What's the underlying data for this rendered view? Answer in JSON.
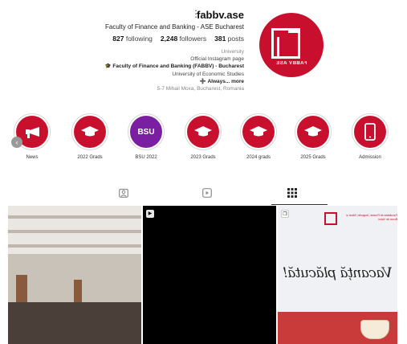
{
  "profile": {
    "username": "fabbv.ase",
    "more_icon": "more-dots-icon",
    "display_name": "Faculty of Finance and Banking - ASE Bucharest",
    "stats": {
      "posts_value": "381",
      "posts_label": "posts",
      "followers_value": "2,248",
      "followers_label": "followers",
      "following_value": "827",
      "following_label": "following"
    },
    "bio": {
      "category": "University",
      "line1": "Official Instagram page",
      "line2": "🎓 Faculty of Finance and Banking (FABBV) - Bucharest",
      "line3": "University of Economic Studies",
      "line4": "➕ Always... more",
      "line5": "5-7 Mihail Moxa, Bucharest, Romania"
    },
    "avatar_text": "FABBV ASE",
    "brand_color": "#c8102e"
  },
  "highlights": [
    {
      "label": "Admission",
      "icon": "phone-icon"
    },
    {
      "label": "2025 Grads",
      "icon": "graduation-cap-icon"
    },
    {
      "label": "2024 grads",
      "icon": "graduation-cap-icon"
    },
    {
      "label": "2023 Grads",
      "icon": "graduation-cap-icon"
    },
    {
      "label": "BSU 2022",
      "icon": "bsu-logo-icon",
      "badge_text": "BSU"
    },
    {
      "label": "2022 Grads",
      "icon": "graduation-cap-icon"
    },
    {
      "label": "News",
      "icon": "megaphone-icon"
    }
  ],
  "tabs": [
    {
      "name": "posts",
      "icon": "grid-icon"
    },
    {
      "name": "reels",
      "icon": "reels-icon"
    },
    {
      "name": "tagged",
      "icon": "tagged-icon"
    }
  ],
  "posts": [
    {
      "type": "carousel",
      "subject": "auditorium"
    },
    {
      "type": "reel",
      "subject": "black"
    },
    {
      "type": "carousel",
      "subject": "christmas-card",
      "header_text": "Facultatea de Finanțe, Asigurări, Bănci și Burse de Valori",
      "script_text": "Vacanță plăcută!"
    }
  ]
}
